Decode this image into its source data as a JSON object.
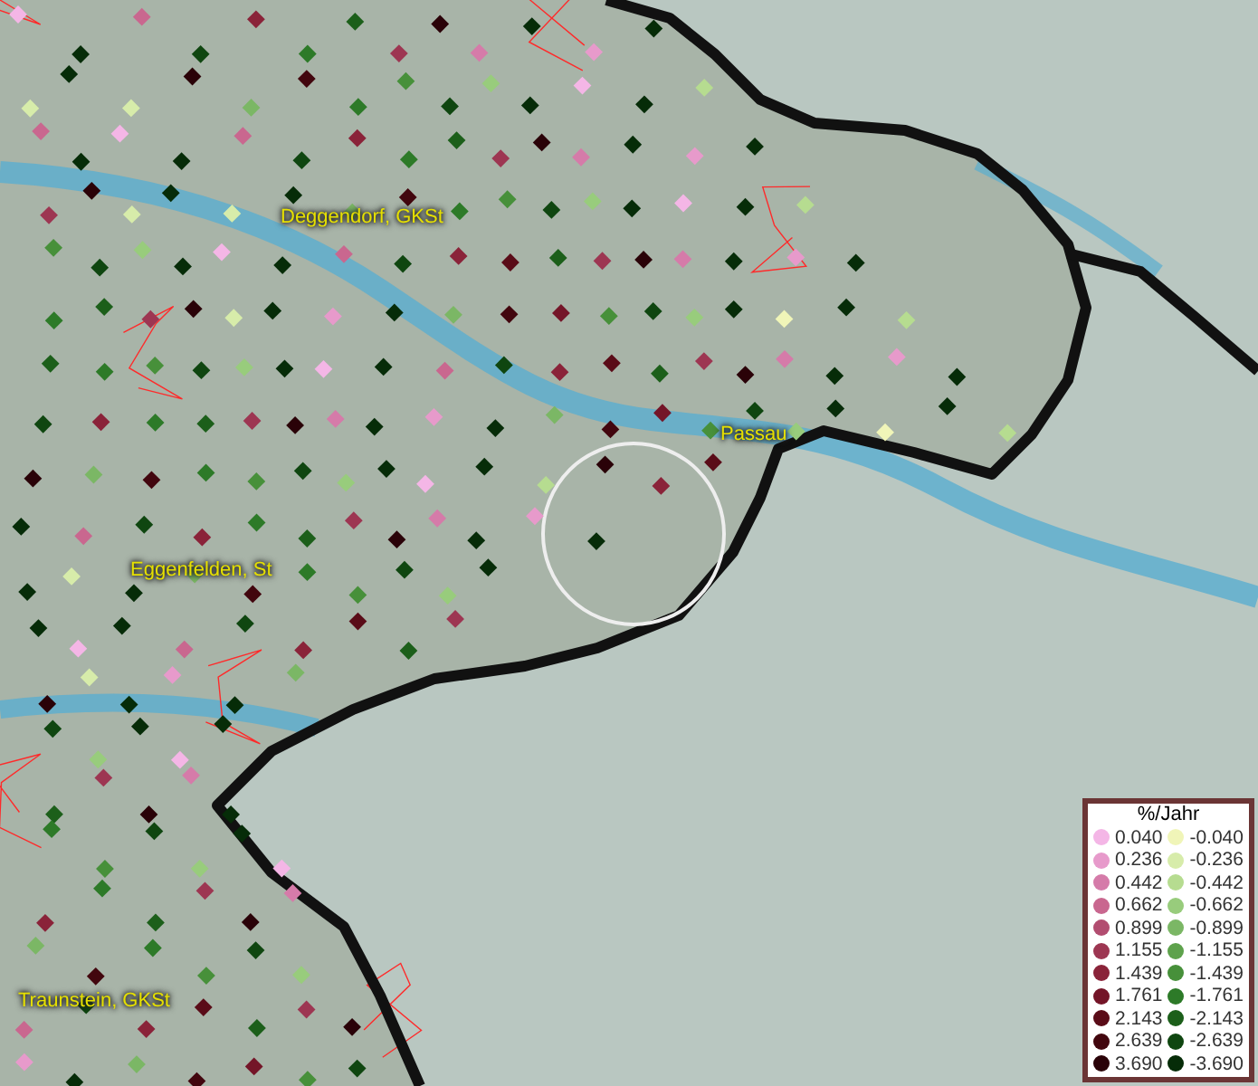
{
  "map": {
    "places": [
      {
        "name": "Deggendorf, GKSt"
      },
      {
        "name": "Passau"
      },
      {
        "name": "Eggenfelden, St"
      },
      {
        "name": "Traunstein, GKSt"
      }
    ]
  },
  "legend": {
    "title": "%/Jahr",
    "rows": [
      {
        "positive": {
          "label": "0.040",
          "color": "#f4b6e6"
        },
        "negative": {
          "label": "-0.040",
          "color": "#f0f5b8"
        }
      },
      {
        "positive": {
          "label": "0.236",
          "color": "#e79acb"
        },
        "negative": {
          "label": "-0.236",
          "color": "#d7ecaa"
        }
      },
      {
        "positive": {
          "label": "0.442",
          "color": "#d57ba9"
        },
        "negative": {
          "label": "-0.442",
          "color": "#b6dc90"
        }
      },
      {
        "positive": {
          "label": "0.662",
          "color": "#c9678f"
        },
        "negative": {
          "label": "-0.662",
          "color": "#98cc7c"
        }
      },
      {
        "positive": {
          "label": "0.899",
          "color": "#b24d70"
        },
        "negative": {
          "label": "-0.899",
          "color": "#7bb765"
        }
      },
      {
        "positive": {
          "label": "1.155",
          "color": "#9d3652"
        },
        "negative": {
          "label": "-1.155",
          "color": "#5ea24c"
        }
      },
      {
        "positive": {
          "label": "1.439",
          "color": "#8a2339"
        },
        "negative": {
          "label": "-1.439",
          "color": "#47903a"
        }
      },
      {
        "positive": {
          "label": "1.761",
          "color": "#741528"
        },
        "negative": {
          "label": "-1.761",
          "color": "#2d7a28"
        }
      },
      {
        "positive": {
          "label": "2.143",
          "color": "#5a0c18"
        },
        "negative": {
          "label": "-2.143",
          "color": "#1c5f1a"
        }
      },
      {
        "positive": {
          "label": "2.639",
          "color": "#42060e"
        },
        "negative": {
          "label": "-2.639",
          "color": "#0f4610"
        }
      },
      {
        "positive": {
          "label": "3.690",
          "color": "#2a0208"
        },
        "negative": {
          "label": "-3.690",
          "color": "#062c08"
        }
      }
    ]
  }
}
